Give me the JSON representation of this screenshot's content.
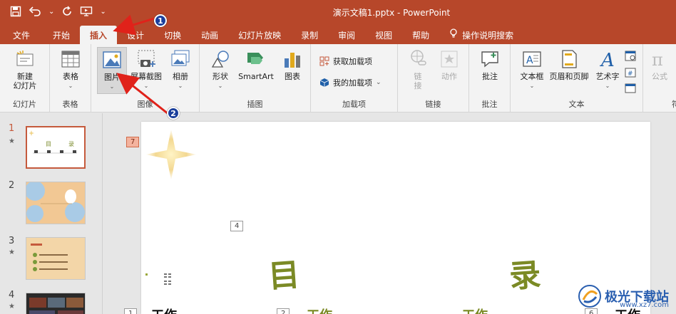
{
  "window": {
    "title": "演示文稿1.pptx  -  PowerPoint",
    "accent": "#b7472a"
  },
  "qat": {
    "save_icon": "save-icon",
    "undo_icon": "undo-icon",
    "redo_icon": "repeat-icon",
    "present_icon": "present-from-start-icon",
    "more": "⌄"
  },
  "tabs": [
    "文件",
    "开始",
    "插入",
    "设计",
    "切换",
    "动画",
    "幻灯片放映",
    "录制",
    "审阅",
    "视图",
    "帮助",
    "操作说明搜索"
  ],
  "active_tab": "插入",
  "ribbon": {
    "slides_group": {
      "label": "幻灯片",
      "new_slide": "新建\n幻灯片"
    },
    "tables_group": {
      "label": "表格",
      "table": "表格"
    },
    "images_group": {
      "label": "图像",
      "pictures": "图片",
      "screenshot": "屏幕截图",
      "album": "相册"
    },
    "illustrations_group": {
      "label": "插图",
      "shapes": "形状",
      "smartart": "SmartArt",
      "chart": "图表"
    },
    "addins_group": {
      "label": "加载项",
      "get_addins": "获取加载项",
      "my_addins": "我的加载项"
    },
    "links_group": {
      "label": "链接",
      "link": "链\n接",
      "action": "动作"
    },
    "comments_group": {
      "label": "批注",
      "comment": "批注"
    },
    "text_group": {
      "label": "文本",
      "textbox": "文本框",
      "header_footer": "页眉和页脚",
      "wordart": "艺术字"
    },
    "symbols_group": {
      "label": "符",
      "equation": "公式"
    }
  },
  "slides": [
    {
      "number": "1",
      "star": "★"
    },
    {
      "number": "2",
      "star": ""
    },
    {
      "number": "3",
      "star": "★"
    },
    {
      "number": "4",
      "star": "★"
    }
  ],
  "slide": {
    "tags": [
      "7",
      "4",
      "1",
      "2",
      "6"
    ],
    "heading_chars": [
      "目",
      "录"
    ],
    "bottom_text": [
      "工作",
      "工作",
      "工作",
      "工作"
    ]
  },
  "annotations": {
    "badge1": "1",
    "badge2": "2"
  },
  "watermark": {
    "text": "极光下载站",
    "url": "www.xz7.com"
  }
}
